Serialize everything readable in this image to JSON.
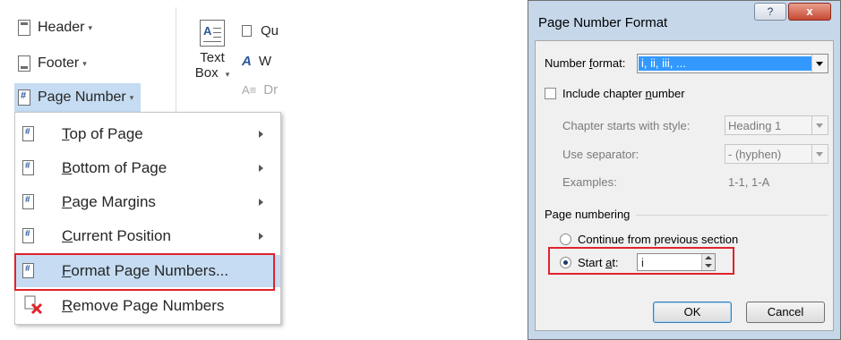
{
  "ribbon": {
    "header_label": "Header",
    "footer_label": "Footer",
    "page_number_label": "Page Number",
    "textbox_label_line1": "Text",
    "textbox_label_line2": "Box",
    "quick_parts_partial": "Qu",
    "wordart_partial": "W",
    "dropcap_partial": "Dr",
    "caret": "▾"
  },
  "menu": {
    "items": [
      {
        "label": "Top of Page",
        "underline": "T",
        "rest": "op of Page",
        "has_submenu": true,
        "icon": "page-top-icon"
      },
      {
        "label": "Bottom of Page",
        "underline": "B",
        "rest": "ottom of Page",
        "has_submenu": true,
        "icon": "page-bottom-icon"
      },
      {
        "label": "Page Margins",
        "underline": "P",
        "rest": "age Margins",
        "has_submenu": true,
        "icon": "page-margins-icon"
      },
      {
        "label": "Current Position",
        "underline": "C",
        "rest": "urrent Position",
        "has_submenu": true,
        "icon": "current-position-icon"
      },
      {
        "label": "Format Page Numbers...",
        "underline": "F",
        "rest": "ormat Page Numbers...",
        "has_submenu": false,
        "icon": "format-page-numbers-icon"
      },
      {
        "label": "Remove Page Numbers",
        "underline": "R",
        "rest": "emove Page Numbers",
        "has_submenu": false,
        "icon": "remove-page-numbers-icon"
      }
    ]
  },
  "dialog": {
    "title": "Page Number Format",
    "help": "?",
    "close": "x",
    "number_format_label_pre": "Number ",
    "number_format_label_ul": "f",
    "number_format_label_post": "ormat:",
    "number_format_value": "i, ii, iii, ...",
    "include_chapter_pre": "Include chapter ",
    "include_chapter_ul": "n",
    "include_chapter_post": "umber",
    "chapter_starts_label": "Chapter starts with style:",
    "chapter_starts_value": "Heading 1",
    "use_separator_label": "Use separator:",
    "use_separator_value": "-   (hyphen)",
    "examples_label": "Examples:",
    "examples_value": "1-1, 1-A",
    "page_numbering_label": "Page numbering",
    "continue_label": "Continue from previous section",
    "start_at_pre": "Start ",
    "start_at_ul": "a",
    "start_at_post": "t:",
    "start_at_value": "i",
    "ok_label": "OK",
    "cancel_label": "Cancel"
  },
  "colors": {
    "highlight": "#c5dcf2",
    "callout_red": "#e2222b",
    "selection_blue": "#3399ff"
  }
}
